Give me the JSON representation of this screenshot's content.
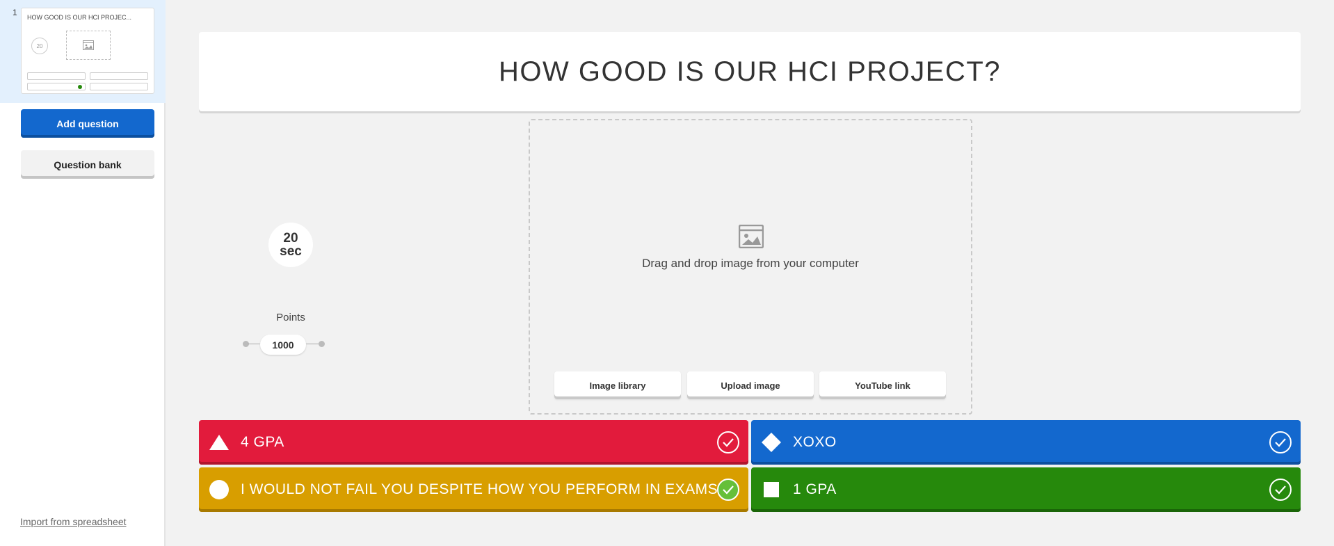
{
  "sidebar": {
    "slide_number": "1",
    "thumb_title": "HOW GOOD IS OUR HCI PROJEC...",
    "thumb_timer": "20",
    "add_question_label": "Add question",
    "question_bank_label": "Question bank",
    "import_label": "Import from spreadsheet"
  },
  "question": {
    "title": "HOW GOOD IS OUR HCI PROJECT?"
  },
  "timer": {
    "value": "20",
    "unit": "sec"
  },
  "points": {
    "label": "Points",
    "value": "1000"
  },
  "media": {
    "drop_text": "Drag and drop image from your computer",
    "image_library_label": "Image library",
    "upload_label": "Upload image",
    "youtube_label": "YouTube link"
  },
  "answers": [
    {
      "text": "4 GPA",
      "shape": "triangle-icon",
      "color": "#e21b3c",
      "correct": false
    },
    {
      "text": "XOXO",
      "shape": "diamond-icon",
      "color": "#1368ce",
      "correct": false
    },
    {
      "text": "I WOULD NOT FAIL YOU DESPITE HOW YOU PERFORM IN EXAMS",
      "shape": "circle-icon",
      "color": "#d89e00",
      "correct": true
    },
    {
      "text": "1 GPA",
      "shape": "square-icon",
      "color": "#26890c",
      "correct": false
    }
  ]
}
